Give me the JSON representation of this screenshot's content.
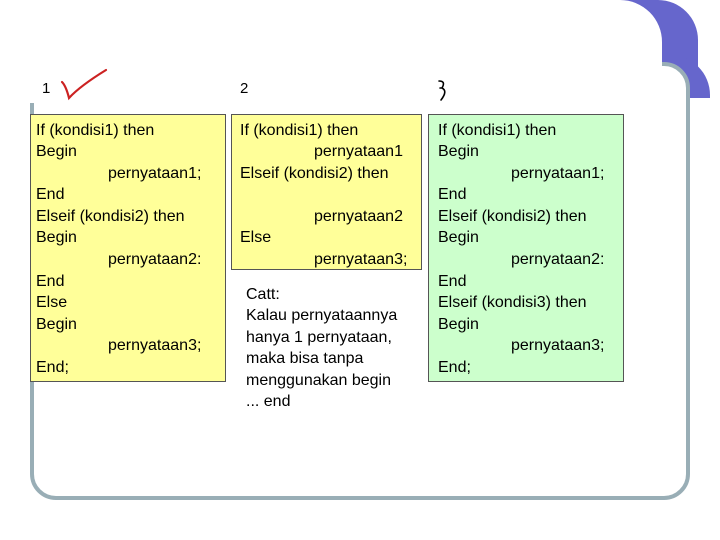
{
  "columns": [
    {
      "number": "1",
      "lines": [
        "If (kondisi1) then",
        "Begin",
        "pernyataan1;",
        "End",
        "Elseif (kondisi2) then",
        "Begin",
        "pernyataan2:",
        "End",
        "Else",
        "Begin",
        "pernyataan3;",
        "End;"
      ]
    },
    {
      "number": "2",
      "lines": [
        "If (kondisi1) then",
        "pernyataan1",
        "Elseif (kondisi2) then",
        "pernyataan2",
        "Else",
        "pernyataan3;"
      ],
      "note": [
        "Catt:",
        "Kalau pernyataannya",
        "hanya 1 pernyataan,",
        "maka bisa tanpa",
        "menggunakan begin",
        "... end"
      ]
    },
    {
      "number": "",
      "lines": [
        "If (kondisi1) then",
        "Begin",
        "pernyataan1;",
        "End",
        "Elseif (kondisi2) then",
        "Begin",
        "pernyataan2:",
        "End",
        "Elseif (kondisi3) then",
        "Begin",
        "pernyataan3;",
        "End;"
      ]
    }
  ],
  "colors": {
    "header": "#6666cc",
    "frame": "#99aeb6",
    "yellow_box": "#ffff99",
    "green_box": "#ccffcc",
    "annotation": "#cc2222"
  },
  "annotations": [
    "checkmark-handwritten",
    "number-three-handwritten"
  ]
}
